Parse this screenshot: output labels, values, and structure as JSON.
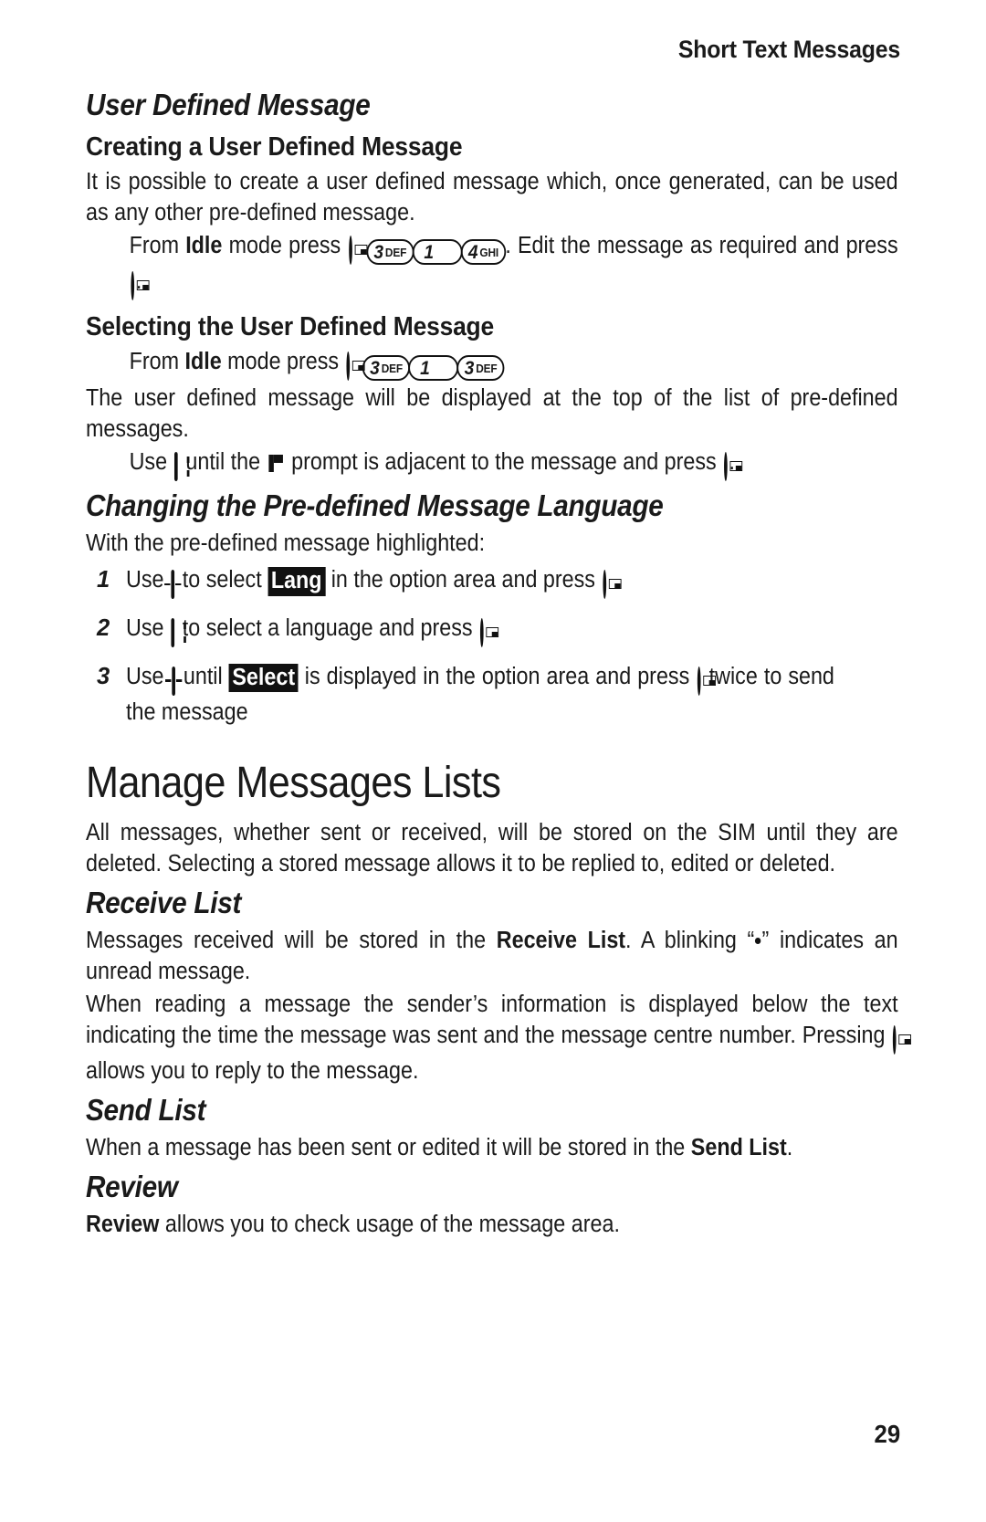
{
  "header": {
    "running_title": "Short Text Messages"
  },
  "sections": {
    "user_defined_message": {
      "title": "User Defined Message",
      "creating": {
        "title": "Creating a User Defined Message",
        "intro": "It is possible to create a user defined message which, once generated, can be used as any other pre-defined message.",
        "step_prefix": "From ",
        "step_idle": "Idle",
        "step_mid": " mode press ",
        "step_after_keys": ". Edit the message as required and press ",
        "step_end": ".",
        "keys": [
          {
            "icon": "softkey-icon",
            "type": "soft"
          },
          {
            "icon": "key-3-def-icon",
            "type": "num",
            "digit": "3",
            "letters": "DEF"
          },
          {
            "icon": "key-1-icon",
            "type": "num",
            "digit": "1",
            "letters": ""
          },
          {
            "icon": "key-4-ghi-icon",
            "type": "num",
            "digit": "4",
            "letters": "GHI"
          }
        ]
      },
      "selecting": {
        "title": "Selecting the User Defined Message",
        "step_prefix": "From ",
        "step_idle": "Idle",
        "step_mid": " mode press ",
        "keys": [
          {
            "icon": "softkey-icon",
            "type": "soft"
          },
          {
            "icon": "key-3-def-icon",
            "type": "num",
            "digit": "3",
            "letters": "DEF"
          },
          {
            "icon": "key-1-icon",
            "type": "num",
            "digit": "1",
            "letters": ""
          },
          {
            "icon": "key-3-def-icon",
            "type": "num",
            "digit": "3",
            "letters": "DEF"
          }
        ],
        "body": "The user defined message will be displayed at the top of the list of pre-defined messages.",
        "use_prefix": "Use ",
        "use_mid": " until the ",
        "use_after_marker": " prompt is adjacent to the message and press ",
        "use_end": "."
      }
    },
    "changing_language": {
      "title": "Changing the Pre-defined Message Language",
      "intro": "With the pre-defined message highlighted:",
      "steps": [
        {
          "num": "1",
          "pre": "Use ",
          "key": "nav-left-right-icon",
          "mid": " to select ",
          "highlight": "Lang",
          "post": " in the option area and press ",
          "end_key": "softkey-icon",
          "tail": ""
        },
        {
          "num": "2",
          "pre": "Use ",
          "key": "nav-up-down-icon",
          "mid": " to select a language and press ",
          "highlight": "",
          "post": "",
          "end_key": "softkey-icon",
          "tail": ""
        },
        {
          "num": "3",
          "pre": "Use ",
          "key": "nav-left-right-icon",
          "mid": " until ",
          "highlight": "Select",
          "post": " is displayed in the option area and press ",
          "end_key": "softkey-icon",
          "tail": " twice to send the message"
        }
      ]
    },
    "manage_messages_lists": {
      "title": "Manage Messages Lists",
      "intro": "All messages, whether sent or received, will be stored on the SIM until they are deleted. Selecting a stored message allows it to be replied to, edited or deleted.",
      "receive_list": {
        "title": "Receive List",
        "p1_a": "Messages received will be stored in the ",
        "p1_b": "Receive List",
        "p1_c": ". A blinking “",
        "p1_d": "” indicates an unread message.",
        "p2_a": "When reading a message the sender’s information is displayed below the text indicating the time the message was sent and the message centre number. Pressing ",
        "p2_key": "softkey-icon",
        "p2_b": " allows you to reply to the message."
      },
      "send_list": {
        "title": "Send List",
        "p1_a": "When a message has been sent or edited it will be stored in the ",
        "p1_b": "Send List",
        "p1_c": "."
      },
      "review": {
        "title": "Review",
        "p1_a": "Review",
        "p1_b": " allows you to check usage of the message area."
      }
    }
  },
  "footer": {
    "page_number": "29"
  }
}
